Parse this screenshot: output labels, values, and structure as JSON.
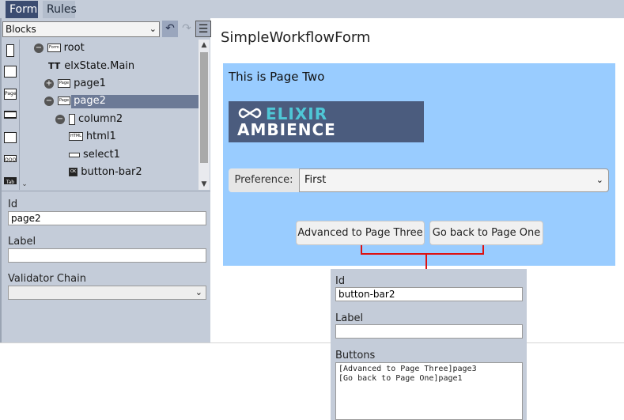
{
  "tabs": [
    {
      "label": "Form",
      "active": true
    },
    {
      "label": "Rules",
      "active": false
    }
  ],
  "sidebar": {
    "blocks_select": "Blocks",
    "palette": [
      {
        "icon": "column-icon",
        "text": ""
      },
      {
        "icon": "two-column-icon",
        "text": ""
      },
      {
        "icon": "page-block-icon",
        "text": "Page"
      },
      {
        "icon": "row-icon",
        "text": ""
      },
      {
        "icon": "split-row-icon",
        "text": ""
      },
      {
        "icon": "button-bar-block-icon",
        "text": "OOO"
      },
      {
        "icon": "tab-block-icon",
        "text": "Tab"
      }
    ],
    "tree": [
      {
        "label": "root",
        "badge": "Form",
        "control": "collapse"
      },
      {
        "label": "elxState.Main",
        "badge": "TT",
        "control": ""
      },
      {
        "label": "page1",
        "badge": "Page",
        "control": "expand"
      },
      {
        "label": "page2",
        "badge": "Page",
        "control": "collapse",
        "selected": true
      },
      {
        "label": "column2",
        "badge": "",
        "control": "collapse"
      },
      {
        "label": "html1",
        "badge": "HTML",
        "control": ""
      },
      {
        "label": "select1",
        "badge": "",
        "control": ""
      },
      {
        "label": "button-bar2",
        "badge": "OK",
        "control": ""
      }
    ],
    "props": {
      "id_label": "Id",
      "id_value": "page2",
      "label_label": "Label",
      "label_value": "",
      "validator_label": "Validator Chain",
      "validator_value": ""
    }
  },
  "canvas": {
    "form_title": "SimpleWorkflowForm",
    "page_heading": "This is Page Two",
    "logo": {
      "line1": "ELIXIR",
      "line2": "AMBIENCE"
    },
    "preference_label": "Preference:",
    "preference_value": "First",
    "buttons": [
      "Advanced to Page Three",
      "Go back to Page One"
    ]
  },
  "popup": {
    "id_label": "Id",
    "id_value": "button-bar2",
    "label_label": "Label",
    "label_value": "",
    "buttons_label": "Buttons",
    "buttons_value": "[Advanced to Page Three]page3\n[Go back to Page One]page1"
  },
  "colors": {
    "panel": "#c4ccd9",
    "active_tab": "#3b4c71",
    "page_bg": "#99ccff",
    "connector": "#dd1111",
    "logo_bg": "#4b5c7e",
    "logo_accent": "#4fc7d6"
  }
}
